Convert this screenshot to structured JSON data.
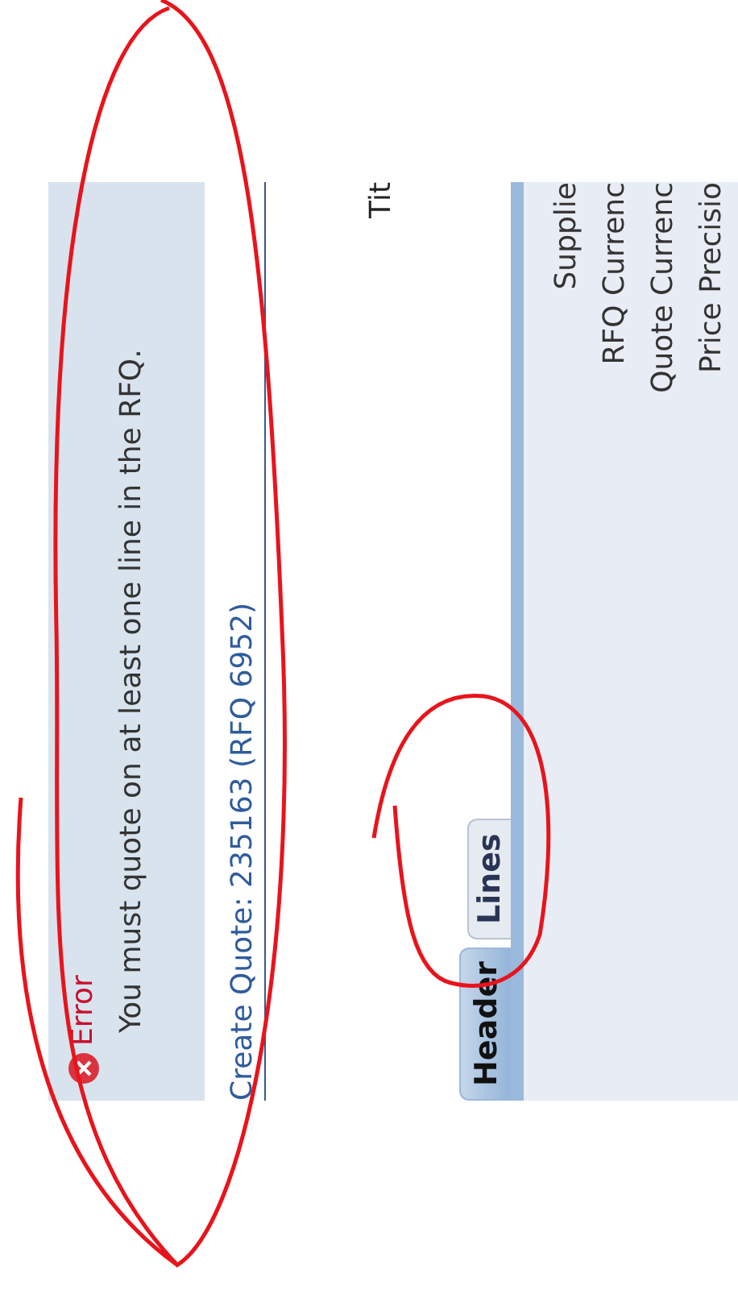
{
  "error": {
    "title": "Error",
    "message": "You must quote on at least one line in the RFQ."
  },
  "page_title": "Create Quote: 235163 (RFQ 6952)",
  "field_label": "Tit",
  "tabs": [
    {
      "label": "Header",
      "selected": true
    },
    {
      "label": "Lines",
      "selected": false
    }
  ],
  "form_labels": [
    "Supplie",
    "RFQ Currenc",
    "Quote Currenc",
    "Price Precisio"
  ]
}
